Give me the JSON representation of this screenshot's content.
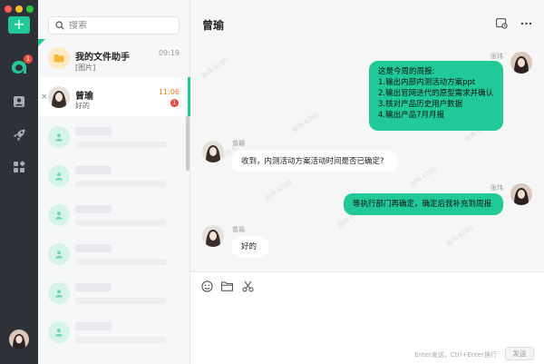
{
  "window": {
    "traffic_lights": [
      "#ff5f57",
      "#febc2e",
      "#28c840"
    ]
  },
  "rail": {
    "add_label": "+",
    "chat_badge": "1",
    "items": [
      {
        "icon": "chat-logo-icon"
      },
      {
        "icon": "contacts-icon"
      },
      {
        "icon": "rocket-icon"
      },
      {
        "icon": "apps-grid-icon"
      }
    ]
  },
  "search": {
    "placeholder": "搜索"
  },
  "conversations": [
    {
      "name": "我的文件助手",
      "time": "09:19",
      "preview": "[图片]",
      "pinned": true
    },
    {
      "name": "曾瑜",
      "time": "11:06",
      "preview": "好的",
      "unread": "1",
      "active": true
    }
  ],
  "chat": {
    "title": "曾瑜",
    "watermark": "张玮 6280",
    "messages": [
      {
        "from": "me",
        "sender": "张玮",
        "lines": [
          "这是今周的周报:",
          "1.输出内部内测活动方案ppt",
          "2.输出官网迭代的原型需求并确认",
          "3.核对产品历史用户数据",
          "4.输出产品7月月报"
        ]
      },
      {
        "from": "them",
        "sender": "曾瑜",
        "lines": [
          "收到，内测活动方案活动时间是否已确定?"
        ]
      },
      {
        "from": "me",
        "sender": "张玮",
        "lines": [
          "等执行部门再确定，确定后我补充到周报"
        ]
      },
      {
        "from": "them",
        "sender": "曾瑜",
        "lines": [
          "好的"
        ]
      }
    ]
  },
  "composer": {
    "tools": [
      "emoji-icon",
      "folder-icon",
      "scissors-icon"
    ],
    "hint": "Enter发送，Ctrl+Enter换行",
    "send_label": "发送"
  },
  "colors": {
    "accent": "#20c997",
    "rail_bg": "#2e3238",
    "badge": "#e74c3c"
  }
}
